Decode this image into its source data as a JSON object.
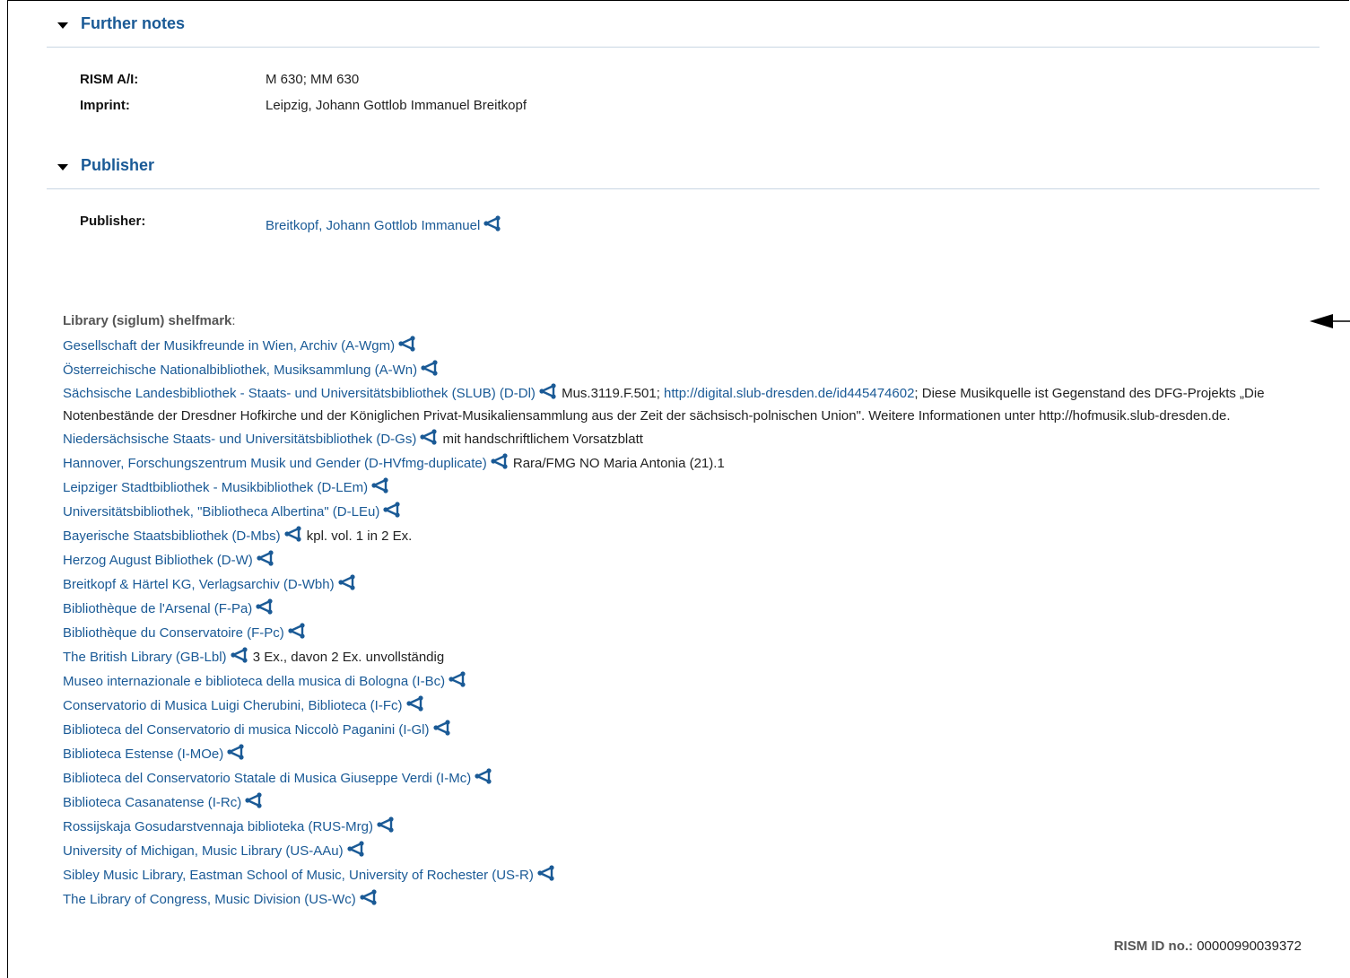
{
  "further_notes": {
    "title": "Further notes",
    "rism_label": "RISM A/I:",
    "rism_value": "M 630; MM 630",
    "imprint_label": "Imprint:",
    "imprint_value": "Leipzig, Johann Gottlob Immanuel Breitkopf"
  },
  "publisher": {
    "title": "Publisher",
    "label": "Publisher:",
    "value": "Breitkopf, Johann Gottlob Immanuel"
  },
  "libraries": {
    "heading_bold": "Library (siglum) shelfmark",
    "heading_tail": ":",
    "items": [
      {
        "name": "Gesellschaft der Musikfreunde in Wien, Archiv (A-Wgm)",
        "note": ""
      },
      {
        "name": "Österreichische Nationalbibliothek, Musiksammlung (A-Wn)",
        "note": ""
      },
      {
        "name": "Sächsische Landesbibliothek - Staats- und Universitätsbibliothek (SLUB) (D-Dl)",
        "note": " Mus.3119.F.501; ",
        "link": "http://digital.slub-dresden.de/id445474602",
        "note2": "; Diese Musikquelle ist Gegenstand des DFG-Projekts „Die Notenbestände der Dresdner Hofkirche und der Königlichen Privat-Musikaliensammlung aus der Zeit der sächsisch-polnischen Union\". Weitere Informationen unter http://hofmusik.slub-dresden.de."
      },
      {
        "name": "Niedersächsische Staats- und Universitätsbibliothek (D-Gs)",
        "note": " mit handschriftlichem Vorsatzblatt"
      },
      {
        "name": "Hannover, Forschungszentrum Musik und Gender (D-HVfmg-duplicate)",
        "note": " Rara/FMG NO Maria Antonia (21).1"
      },
      {
        "name": "Leipziger Stadtbibliothek - Musikbibliothek (D-LEm)",
        "note": ""
      },
      {
        "name": "Universitätsbibliothek, \"Bibliotheca Albertina\" (D-LEu)",
        "note": ""
      },
      {
        "name": "Bayerische Staatsbibliothek (D-Mbs)",
        "note": " kpl. vol. 1 in 2 Ex."
      },
      {
        "name": "Herzog August Bibliothek (D-W)",
        "note": ""
      },
      {
        "name": "Breitkopf & Härtel KG, Verlagsarchiv (D-Wbh)",
        "note": ""
      },
      {
        "name": "Bibliothèque de l'Arsenal (F-Pa)",
        "note": ""
      },
      {
        "name": "Bibliothèque du Conservatoire (F-Pc)",
        "note": ""
      },
      {
        "name": "The British Library (GB-Lbl)",
        "note": " 3 Ex., davon 2 Ex. unvollständig"
      },
      {
        "name": "Museo internazionale e biblioteca della musica di Bologna (I-Bc)",
        "note": ""
      },
      {
        "name": "Conservatorio di Musica Luigi Cherubini, Biblioteca (I-Fc)",
        "note": ""
      },
      {
        "name": "Biblioteca del Conservatorio di musica Niccolò Paganini (I-Gl)",
        "note": ""
      },
      {
        "name": "Biblioteca Estense (I-MOe)",
        "note": ""
      },
      {
        "name": "Biblioteca del Conservatorio Statale di Musica Giuseppe Verdi (I-Mc)",
        "note": ""
      },
      {
        "name": "Biblioteca Casanatense (I-Rc)",
        "note": ""
      },
      {
        "name": "Rossijskaja Gosudarstvennaja biblioteka (RUS-Mrg)",
        "note": ""
      },
      {
        "name": "University of Michigan, Music Library (US-AAu)",
        "note": ""
      },
      {
        "name": "Sibley Music Library, Eastman School of Music, University of Rochester (US-R)",
        "note": ""
      },
      {
        "name": "The Library of Congress, Music Division (US-Wc)",
        "note": ""
      }
    ]
  },
  "rism_id": {
    "label": "RISM ID no.:",
    "value": " 00000990039372"
  },
  "colors": {
    "link": "#1a5a96",
    "divider": "#c9d6e3"
  },
  "icons": {
    "share": "share-icon",
    "collapse": "triangle-down-icon",
    "arrow": "arrow-left-icon"
  }
}
